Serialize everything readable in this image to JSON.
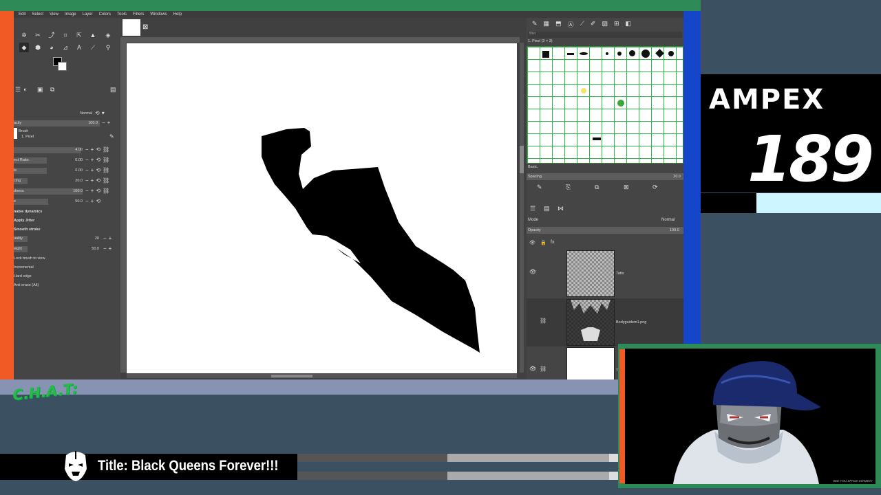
{
  "gimp": {
    "menu": [
      "Edit",
      "Select",
      "View",
      "Image",
      "Layer",
      "Colors",
      "Tools",
      "Filters",
      "Windows",
      "Help"
    ],
    "tool_options": {
      "mode_label": "Normal",
      "opacity_label": "acity",
      "opacity_value": "100.0",
      "brush_label": "Brush",
      "brush_name": "1. Pixel",
      "rows": [
        {
          "label": "",
          "value": "4.00"
        },
        {
          "label": "ect Ratio",
          "value": "0.00"
        },
        {
          "label": "le",
          "value": "0.00"
        },
        {
          "label": "cing",
          "value": "20.0"
        },
        {
          "label": "dness",
          "value": "100.0"
        },
        {
          "label": "e",
          "value": "50.0"
        }
      ],
      "enable_dynamics": "nable dynamics",
      "apply_jitter": "Apply Jitter",
      "smooth_stroke": "Smooth stroke",
      "quality_label": "uality",
      "quality_value": "20",
      "weight_label": "eight",
      "weight_value": "50.0",
      "lock_brush": "Lock brush to view",
      "incremental": "Incremental",
      "hard_edge": "Hard edge",
      "anti_erase": "Anti erase  (Alt)"
    },
    "brushes": {
      "filter_placeholder": "filter",
      "current_brush": "1. Pixel (3 × 3)",
      "tag": "Basic,",
      "spacing_label": "Spacing",
      "spacing_value": "20.0"
    },
    "layers": {
      "mode_label": "Mode",
      "mode_value": "Normal",
      "opacity_label": "Opacity",
      "opacity_value": "100.0",
      "items": [
        {
          "name": "Tatts"
        },
        {
          "name": "Bodyguidem1.png"
        },
        {
          "name": "Ta"
        }
      ]
    }
  },
  "overlay": {
    "brand_name": "AMPEX",
    "brand_number": "189",
    "chat_logo": "C.H.A.T:",
    "stream_title": "Title: Black Queens Forever!!!",
    "cam_caption": "SEE YOU SPACE COWBOY"
  },
  "colors": {
    "accent_green": "#2e8b57",
    "accent_orange": "#f15a24",
    "accent_blue": "#1545c8",
    "chat_green": "#2ab84a",
    "light_cyan": "#cdf5ff"
  }
}
